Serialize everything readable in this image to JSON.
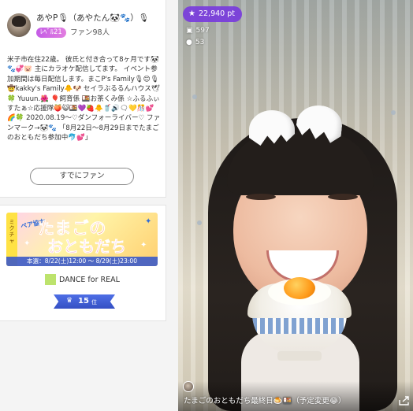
{
  "profile": {
    "name": "あやP🎙（あやたん🐼🐾）🎙",
    "level": "ﾚﾍﾞﾙ21",
    "fans": "ファン98人",
    "bio": "米子市在住22歳。 彼氏と付き合って8ヶ月です🐼🐾💞🐷 主にカラオケ配信してます。 イベント参加期間は毎日配信します。まこP's Family🎙😊🎙 🤠kakky's Family🐥🐶 セイラぶるるんハウス🕊🍀 Yuuun.🌺 🎈飼育係 🍱お茶くみ係 ☆ふるふぃすたぁ☆応援隊🍑😺🍱💜🍓🐥🥤🔊🗨💛🎊💕🌈🍀 2020.08.19〜♡ダンフォーライバー♡ ファンマーク→🐼🐾 「8月22日〜8月29日までたまごのおともだち参加中🐬💕」",
    "fan_button": "すでにファン",
    "colors": {
      "level_badge": "#c45ce6"
    }
  },
  "event": {
    "banner_tag": "ミクチャ",
    "banner_sub": "ペア協力",
    "banner_title_1": "たまごの",
    "banner_title_2": "おともだち",
    "banner_date": "本選：8/22(土)12:00 〜 8/29(土)23:00",
    "name": "DANCE for REAL",
    "rank": "15",
    "rank_unit": "位",
    "crown_icon": "crown-icon",
    "colors": {
      "event_swatch": "#bde36d",
      "rank_ribbon": "#3f5fd6"
    }
  },
  "stream": {
    "points": "22,940 pt",
    "viewers": "597",
    "comments": "53",
    "caption": "たまごのおともだち最終日🍮🍱（予定変更😂）",
    "colors": {
      "points_badge": "#7a3cdc"
    }
  }
}
